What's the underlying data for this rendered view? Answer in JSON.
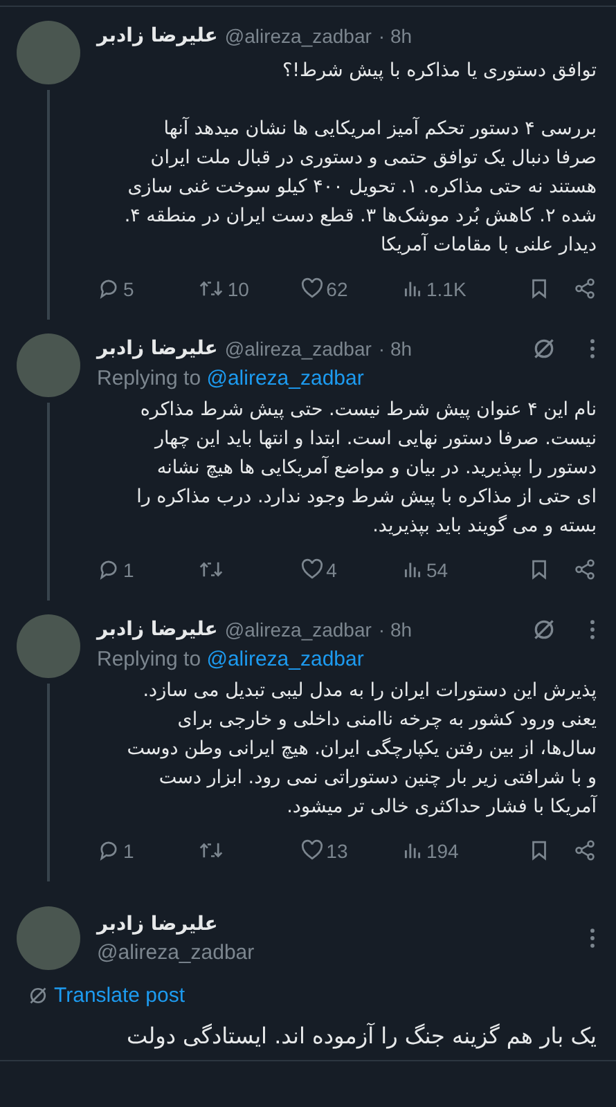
{
  "tweets": [
    {
      "kind": "inline",
      "name": "علیرضا زادبر",
      "handle": "@alireza_zadbar",
      "time": "· 8h",
      "grok": false,
      "menu": false,
      "thread_line": true,
      "paragraphs": [
        [
          "توافق دستوری یا مذاکره با پیش شرط!؟"
        ],
        [
          "بررسی ۴ دستور تحکم آمیز امریکایی ها نشان میدهد آنها",
          "صرفا دنبال یک توافق حتمی و دستوری در قبال ملت ایران",
          "هستند نه حتی مذاکره. ۱. تحویل ۴۰۰ کیلو سوخت غنی سازی",
          "شده ۲. کاهش بُرد موشک‌ها ۳. قطع دست ایران در منطقه ۴.",
          "دیدار علنی با مقامات آمریکا"
        ]
      ],
      "stats": {
        "replies": "5",
        "reposts": "10",
        "likes": "62",
        "views": "1.1K"
      }
    },
    {
      "kind": "inline",
      "name": "علیرضا زادبر",
      "handle": "@alireza_zadbar",
      "time": "· 8h",
      "grok": true,
      "menu": true,
      "thread_line": true,
      "replying_to": {
        "label": "Replying to",
        "handle": "@alireza_zadbar"
      },
      "paragraphs": [
        [
          "نام این ۴ عنوان پیش شرط نیست. حتی پیش شرط مذاکره",
          "نیست. صرفا دستور نهایی است. ابتدا و انتها باید این چهار",
          "دستور را بپذیرید. در بیان و مواضع آمریکایی ها هیچ نشانه",
          "ای حتی از مذاکره با پیش شرط وجود ندارد. درب مذاکره را",
          "بسته و می گویند باید بپذیرید."
        ]
      ],
      "stats": {
        "replies": "1",
        "likes": "4",
        "views": "54"
      }
    },
    {
      "kind": "inline",
      "name": "علیرضا زادبر",
      "handle": "@alireza_zadbar",
      "time": "· 8h",
      "grok": true,
      "menu": true,
      "thread_line": true,
      "replying_to": {
        "label": "Replying to",
        "handle": "@alireza_zadbar"
      },
      "paragraphs": [
        [
          "پذیرش این دستورات ایران را به مدل لیبی تبدیل می سازد.",
          "یعنی ورود کشور به چرخه ناامنی داخلی و خارجی برای",
          "سال‌ها، از بین رفتن یکپارچگی ایران. هیچ ایرانی وطن دوست",
          "و با شرافتی زیر بار چنین دستوراتی نمی رود. ابزار دست",
          "آمریکا با فشار حداکثری خالی تر میشود."
        ]
      ],
      "stats": {
        "replies": "1",
        "likes": "13",
        "views": "194"
      }
    },
    {
      "kind": "stacked",
      "name": "علیرضا زادبر",
      "handle": "@alireza_zadbar",
      "menu": true,
      "translate": "Translate post",
      "paragraphs": [
        [
          "یک بار هم گزینه جنگ را آزموده اند. ایستادگی دولت"
        ]
      ]
    }
  ]
}
